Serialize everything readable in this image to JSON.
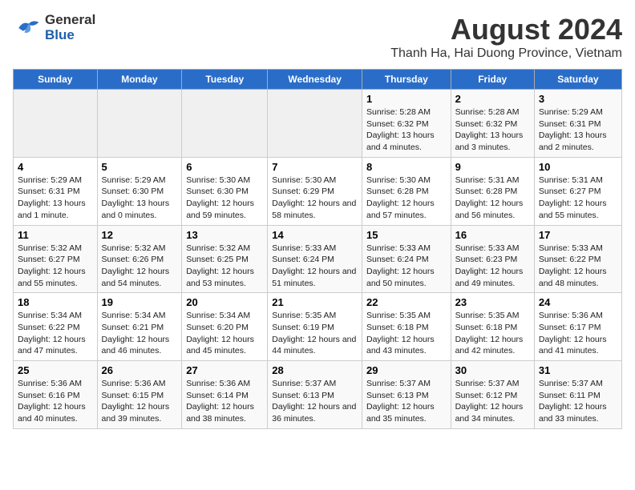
{
  "header": {
    "logo_general": "General",
    "logo_blue": "Blue",
    "title": "August 2024",
    "subtitle": "Thanh Ha, Hai Duong Province, Vietnam"
  },
  "calendar": {
    "days_of_week": [
      "Sunday",
      "Monday",
      "Tuesday",
      "Wednesday",
      "Thursday",
      "Friday",
      "Saturday"
    ],
    "weeks": [
      {
        "cells": [
          {
            "day": "",
            "info": ""
          },
          {
            "day": "",
            "info": ""
          },
          {
            "day": "",
            "info": ""
          },
          {
            "day": "",
            "info": ""
          },
          {
            "day": "1",
            "info": "Sunrise: 5:28 AM\nSunset: 6:32 PM\nDaylight: 13 hours and 4 minutes."
          },
          {
            "day": "2",
            "info": "Sunrise: 5:28 AM\nSunset: 6:32 PM\nDaylight: 13 hours and 3 minutes."
          },
          {
            "day": "3",
            "info": "Sunrise: 5:29 AM\nSunset: 6:31 PM\nDaylight: 13 hours and 2 minutes."
          }
        ]
      },
      {
        "cells": [
          {
            "day": "4",
            "info": "Sunrise: 5:29 AM\nSunset: 6:31 PM\nDaylight: 13 hours and 1 minute."
          },
          {
            "day": "5",
            "info": "Sunrise: 5:29 AM\nSunset: 6:30 PM\nDaylight: 13 hours and 0 minutes."
          },
          {
            "day": "6",
            "info": "Sunrise: 5:30 AM\nSunset: 6:30 PM\nDaylight: 12 hours and 59 minutes."
          },
          {
            "day": "7",
            "info": "Sunrise: 5:30 AM\nSunset: 6:29 PM\nDaylight: 12 hours and 58 minutes."
          },
          {
            "day": "8",
            "info": "Sunrise: 5:30 AM\nSunset: 6:28 PM\nDaylight: 12 hours and 57 minutes."
          },
          {
            "day": "9",
            "info": "Sunrise: 5:31 AM\nSunset: 6:28 PM\nDaylight: 12 hours and 56 minutes."
          },
          {
            "day": "10",
            "info": "Sunrise: 5:31 AM\nSunset: 6:27 PM\nDaylight: 12 hours and 55 minutes."
          }
        ]
      },
      {
        "cells": [
          {
            "day": "11",
            "info": "Sunrise: 5:32 AM\nSunset: 6:27 PM\nDaylight: 12 hours and 55 minutes."
          },
          {
            "day": "12",
            "info": "Sunrise: 5:32 AM\nSunset: 6:26 PM\nDaylight: 12 hours and 54 minutes."
          },
          {
            "day": "13",
            "info": "Sunrise: 5:32 AM\nSunset: 6:25 PM\nDaylight: 12 hours and 53 minutes."
          },
          {
            "day": "14",
            "info": "Sunrise: 5:33 AM\nSunset: 6:24 PM\nDaylight: 12 hours and 51 minutes."
          },
          {
            "day": "15",
            "info": "Sunrise: 5:33 AM\nSunset: 6:24 PM\nDaylight: 12 hours and 50 minutes."
          },
          {
            "day": "16",
            "info": "Sunrise: 5:33 AM\nSunset: 6:23 PM\nDaylight: 12 hours and 49 minutes."
          },
          {
            "day": "17",
            "info": "Sunrise: 5:33 AM\nSunset: 6:22 PM\nDaylight: 12 hours and 48 minutes."
          }
        ]
      },
      {
        "cells": [
          {
            "day": "18",
            "info": "Sunrise: 5:34 AM\nSunset: 6:22 PM\nDaylight: 12 hours and 47 minutes."
          },
          {
            "day": "19",
            "info": "Sunrise: 5:34 AM\nSunset: 6:21 PM\nDaylight: 12 hours and 46 minutes."
          },
          {
            "day": "20",
            "info": "Sunrise: 5:34 AM\nSunset: 6:20 PM\nDaylight: 12 hours and 45 minutes."
          },
          {
            "day": "21",
            "info": "Sunrise: 5:35 AM\nSunset: 6:19 PM\nDaylight: 12 hours and 44 minutes."
          },
          {
            "day": "22",
            "info": "Sunrise: 5:35 AM\nSunset: 6:18 PM\nDaylight: 12 hours and 43 minutes."
          },
          {
            "day": "23",
            "info": "Sunrise: 5:35 AM\nSunset: 6:18 PM\nDaylight: 12 hours and 42 minutes."
          },
          {
            "day": "24",
            "info": "Sunrise: 5:36 AM\nSunset: 6:17 PM\nDaylight: 12 hours and 41 minutes."
          }
        ]
      },
      {
        "cells": [
          {
            "day": "25",
            "info": "Sunrise: 5:36 AM\nSunset: 6:16 PM\nDaylight: 12 hours and 40 minutes."
          },
          {
            "day": "26",
            "info": "Sunrise: 5:36 AM\nSunset: 6:15 PM\nDaylight: 12 hours and 39 minutes."
          },
          {
            "day": "27",
            "info": "Sunrise: 5:36 AM\nSunset: 6:14 PM\nDaylight: 12 hours and 38 minutes."
          },
          {
            "day": "28",
            "info": "Sunrise: 5:37 AM\nSunset: 6:13 PM\nDaylight: 12 hours and 36 minutes."
          },
          {
            "day": "29",
            "info": "Sunrise: 5:37 AM\nSunset: 6:13 PM\nDaylight: 12 hours and 35 minutes."
          },
          {
            "day": "30",
            "info": "Sunrise: 5:37 AM\nSunset: 6:12 PM\nDaylight: 12 hours and 34 minutes."
          },
          {
            "day": "31",
            "info": "Sunrise: 5:37 AM\nSunset: 6:11 PM\nDaylight: 12 hours and 33 minutes."
          }
        ]
      }
    ]
  }
}
